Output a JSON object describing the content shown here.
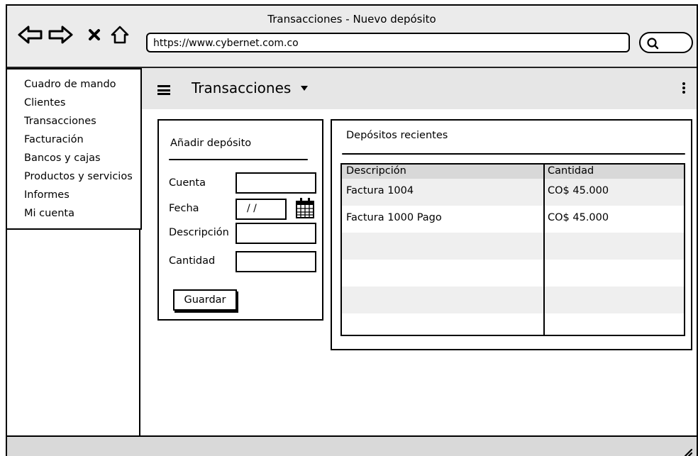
{
  "window": {
    "title": "Transacciones - Nuevo depósito",
    "url": "https://www.cybernet.com.co"
  },
  "browser_icons": [
    "back-arrow-icon",
    "forward-arrow-icon",
    "close-icon",
    "home-icon",
    "search-icon"
  ],
  "sidebar": {
    "items": [
      {
        "label": "Cuadro de mando"
      },
      {
        "label": "Clientes"
      },
      {
        "label": "Transacciones"
      },
      {
        "label": "Facturación"
      },
      {
        "label": "Bancos y cajas"
      },
      {
        "label": "Productos y servicios"
      },
      {
        "label": "Informes"
      },
      {
        "label": "Mi cuenta"
      }
    ]
  },
  "appbar": {
    "title": "Transacciones"
  },
  "form": {
    "header": "Añadir depósito",
    "fields": {
      "account_label": "Cuenta",
      "date_label": "Fecha",
      "date_value": "/ /",
      "description_label": "Descripción",
      "amount_label": "Cantidad"
    },
    "save_label": "Guardar"
  },
  "recent": {
    "title": "Depósitos recientes",
    "columns": [
      "Descripción",
      "Cantidad"
    ],
    "rows": [
      {
        "description": "Factura 1004",
        "amount": "CO$ 45.000"
      },
      {
        "description": "Factura 1000 Pago",
        "amount": "CO$ 45.000"
      },
      {
        "description": "",
        "amount": ""
      },
      {
        "description": "",
        "amount": ""
      },
      {
        "description": "",
        "amount": ""
      },
      {
        "description": "",
        "amount": ""
      }
    ]
  },
  "colors": {
    "titlebar": "#ebebeb",
    "appbar": "#e6e6e6",
    "table_header": "#d8d8d8",
    "row_shade": "#efefef",
    "statusbar": "#d9d9d9"
  }
}
